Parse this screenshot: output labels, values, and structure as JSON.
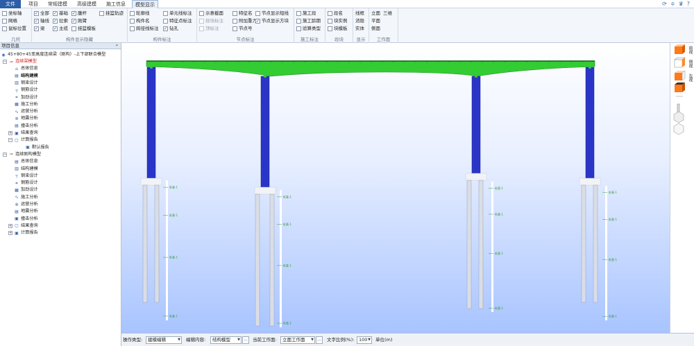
{
  "menu": {
    "tabs": [
      "文件",
      "项目",
      "常规建模",
      "高级建模",
      "施工信息",
      "模型显示"
    ],
    "active": "模型显示"
  },
  "ribbon": {
    "groups": [
      {
        "label": "几何",
        "items": [
          {
            "t": "坐标轴",
            "c": false
          },
          {
            "t": "网格",
            "c": false
          },
          {
            "t": "鼠标位置",
            "c": false
          }
        ]
      },
      {
        "label": "构件显示隐藏",
        "items": [
          {
            "t": "全部",
            "c": true
          },
          {
            "t": "基础",
            "c": true
          },
          {
            "t": "腹杆",
            "c": true
          },
          {
            "t": "挂篮轨迹",
            "c": false
          },
          {
            "t": "轴线",
            "c": true
          },
          {
            "t": "拉索",
            "c": true
          },
          {
            "t": "刚臂",
            "c": true
          },
          {
            "t": "梁",
            "c": true
          },
          {
            "t": "主缆",
            "c": true
          },
          {
            "t": "挂篮模板",
            "c": false
          }
        ]
      },
      {
        "label": "构件标注",
        "items": [
          {
            "t": "轮廓线",
            "c": false
          },
          {
            "t": "单元线标注",
            "c": false
          },
          {
            "t": "构件名",
            "c": false
          },
          {
            "t": "特征点标注",
            "c": false
          },
          {
            "t": "跨径线标注",
            "c": false
          },
          {
            "t": "钻孔",
            "c": true
          }
        ]
      },
      {
        "label": "节点标注",
        "items": [
          {
            "t": "示意截面",
            "c": false
          },
          {
            "t": "特征名",
            "c": false
          },
          {
            "t": "节点显示短线",
            "c": false
          },
          {
            "t": "现场标注",
            "c": false,
            "d": true
          },
          {
            "t": "附加重力",
            "c": false
          },
          {
            "t": "节点显示方块",
            "c": true
          },
          {
            "t": "顶标注",
            "c": false,
            "d": true
          },
          {
            "t": "节点号",
            "c": false
          }
        ]
      },
      {
        "label": "施工标注",
        "items": [
          {
            "t": "施工段",
            "c": false
          },
          {
            "t": "施工龄期",
            "c": false
          },
          {
            "t": "验算类型",
            "c": false
          }
        ]
      },
      {
        "label": "段块",
        "items": [
          {
            "t": "段名",
            "c": false
          },
          {
            "t": "块实例",
            "c": false
          },
          {
            "t": "块模板",
            "c": false
          }
        ]
      },
      {
        "label": "显示",
        "items": [
          {
            "t": "线框"
          },
          {
            "t": "消隐"
          },
          {
            "t": "实体"
          }
        ]
      },
      {
        "label": "工作面",
        "items": [
          {
            "t": "立面"
          },
          {
            "t": "三维"
          },
          {
            "t": "平面"
          },
          {
            "t": "侧面"
          }
        ]
      }
    ]
  },
  "panel": {
    "title": "项目信息",
    "pin": "ᵖ",
    "project": "45+80+45变高度连续梁（刚构）-上下部联合模型",
    "tree": [
      {
        "l": 1,
        "t": "连续梁模型",
        "red": true,
        "e": "−"
      },
      {
        "l": 2,
        "t": "总体信息"
      },
      {
        "l": 2,
        "t": "结构建模",
        "bold": true
      },
      {
        "l": 2,
        "t": "钢束设计"
      },
      {
        "l": 2,
        "t": "钢筋设计"
      },
      {
        "l": 2,
        "t": "加劲设计"
      },
      {
        "l": 2,
        "t": "施工分析"
      },
      {
        "l": 2,
        "t": "运营分析"
      },
      {
        "l": 2,
        "t": "地震分析"
      },
      {
        "l": 2,
        "t": "撞击分析"
      },
      {
        "l": 2,
        "t": "结果查询",
        "e": "+"
      },
      {
        "l": 2,
        "t": "计算报告",
        "e": "−"
      },
      {
        "l": 3,
        "t": "默认报告"
      },
      {
        "l": 1,
        "t": "连续刚构模型",
        "e": "−"
      },
      {
        "l": 2,
        "t": "总体信息"
      },
      {
        "l": 2,
        "t": "结构建模"
      },
      {
        "l": 2,
        "t": "钢束设计"
      },
      {
        "l": 2,
        "t": "钢筋设计"
      },
      {
        "l": 2,
        "t": "加劲设计"
      },
      {
        "l": 2,
        "t": "施工分析"
      },
      {
        "l": 2,
        "t": "运营分析"
      },
      {
        "l": 2,
        "t": "地震分析"
      },
      {
        "l": 2,
        "t": "撞击分析"
      },
      {
        "l": 2,
        "t": "结果查询",
        "e": "+"
      },
      {
        "l": 2,
        "t": "计算报告",
        "e": "+"
      }
    ]
  },
  "rightbar": {
    "labels": [
      "前视",
      "侧视",
      "左视"
    ]
  },
  "viewport": {
    "pile_label": "桩基-1",
    "colors": {
      "deck": "#33cc33",
      "pier": "#2a35c8",
      "pile": "#d9dde6",
      "bg_top": "#ffffff",
      "bg_bottom": "#a8c4ff"
    }
  },
  "status": {
    "op_label": "操作类型:",
    "op_value": "建模编辑",
    "edit_label": "编辑内容:",
    "edit_value": "结构模型",
    "work_label": "当前工作面:",
    "work_value": "立面工作面",
    "scale_label": "文字比例(%):",
    "scale_value": "100",
    "unit_label": "单位(m)",
    "more": "..."
  }
}
